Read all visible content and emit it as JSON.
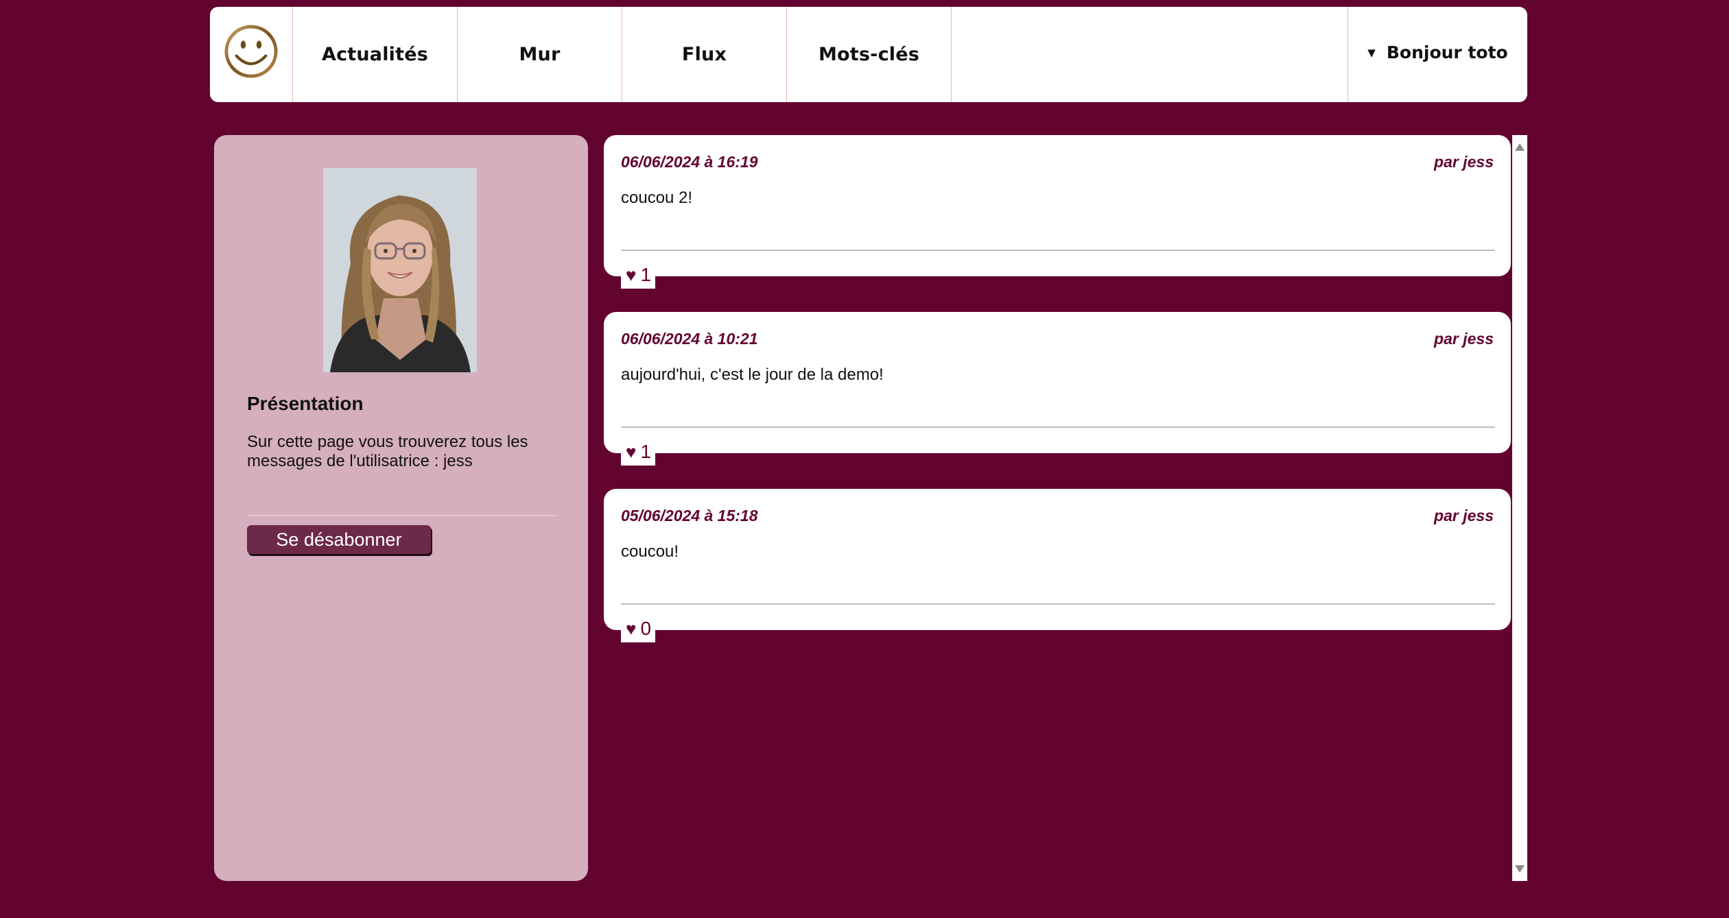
{
  "header": {
    "nav": [
      {
        "label": "Actualités"
      },
      {
        "label": "Mur"
      },
      {
        "label": "Flux"
      },
      {
        "label": "Mots-clés"
      }
    ],
    "user_menu": "Bonjour toto",
    "logo_icon": "smiley-icon"
  },
  "sidebar": {
    "title": "Présentation",
    "description": "Sur cette page vous trouverez tous les messages de l'utilisatrice : jess",
    "unsubscribe_label": "Se désabonner"
  },
  "posts": [
    {
      "date": "06/06/2024 à 16:19",
      "author": "par jess",
      "body": "coucou 2!",
      "likes": "1"
    },
    {
      "date": "06/06/2024 à 10:21",
      "author": "par jess",
      "body": "aujourd'hui, c'est le jour de la demo!",
      "likes": "1"
    },
    {
      "date": "05/06/2024 à 15:18",
      "author": "par jess",
      "body": "coucou!",
      "likes": "0"
    }
  ],
  "colors": {
    "background": "#63032f",
    "sidebar": "#d5afbe",
    "accent": "#6c2a48"
  }
}
